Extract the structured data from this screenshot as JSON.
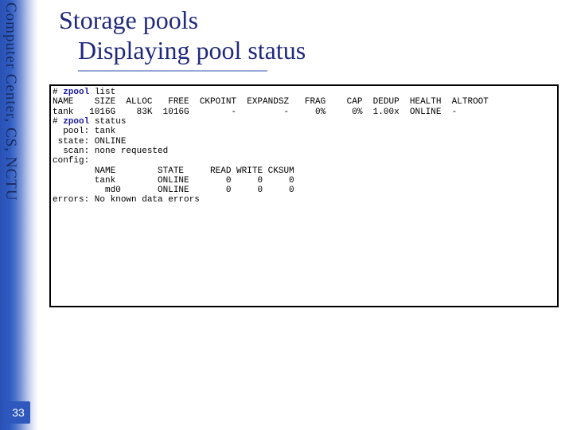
{
  "sidebar": {
    "org": "Computer Center, CS, NCTU"
  },
  "page": {
    "number": "33"
  },
  "title": {
    "line1": "Storage pools",
    "line2": "Displaying pool status"
  },
  "term": {
    "cmd1_prompt": "# ",
    "cmd1_kw": "zpool",
    "cmd1_rest": " list",
    "list_header": "NAME    SIZE  ALLOC   FREE  CKPOINT  EXPANDSZ   FRAG    CAP  DEDUP  HEALTH  ALTROOT",
    "list_row": "tank   1016G    83K  1016G        -         -     0%     0%  1.00x  ONLINE  -",
    "blank": "",
    "cmd2_prompt": "# ",
    "cmd2_kw": "zpool",
    "cmd2_rest": " status",
    "s_pool": "  pool: tank",
    "s_state": " state: ONLINE",
    "s_scan": "  scan: none requested",
    "s_config": "config:",
    "cfg_hdr": "        NAME        STATE     READ WRITE CKSUM",
    "cfg_r1": "        tank        ONLINE       0     0     0",
    "cfg_r2": "          md0       ONLINE       0     0     0",
    "errors": "errors: No known data errors"
  }
}
